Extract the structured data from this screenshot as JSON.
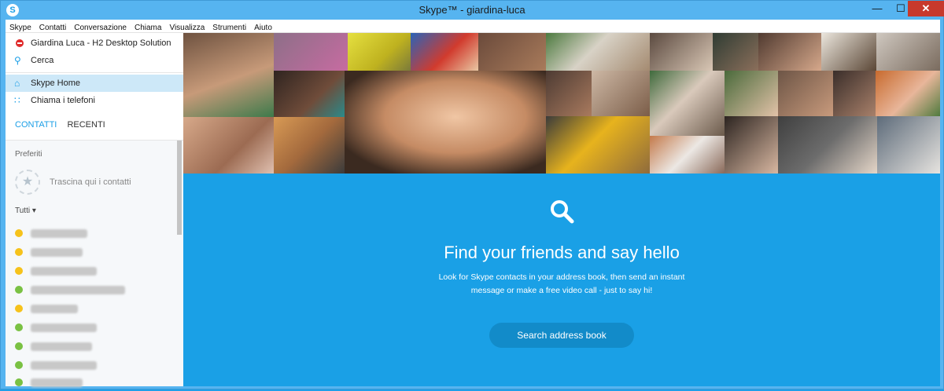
{
  "window": {
    "title": "Skype™ - giardina-luca",
    "controls": {
      "minimize": "—",
      "maximize": "☐",
      "close": "✕"
    }
  },
  "menu": [
    "Skype",
    "Contatti",
    "Conversazione",
    "Chiama",
    "Visualizza",
    "Strumenti",
    "Aiuto"
  ],
  "sidebar": {
    "profile_name": "Giardina Luca - H2 Desktop Solution",
    "search_label": "Cerca",
    "home_label": "Skype Home",
    "phones_label": "Chiama i telefoni",
    "tabs": {
      "contacts": "CONTATTI",
      "recent": "RECENTI"
    },
    "favorites_label": "Preferiti",
    "drag_here": "Trascina qui i contatti",
    "all_label": "Tutti ▾",
    "contacts": [
      {
        "status": "away"
      },
      {
        "status": "away"
      },
      {
        "status": "away"
      },
      {
        "status": "online"
      },
      {
        "status": "away"
      },
      {
        "status": "online"
      },
      {
        "status": "online"
      },
      {
        "status": "online"
      },
      {
        "status": "online"
      }
    ]
  },
  "hero": {
    "title": "Find your friends and say hello",
    "subtitle": "Look for Skype contacts in your address book, then send an instant message or make a free video call - just to say hi!",
    "button": "Search address book"
  },
  "colors": {
    "accent": "#1aa0e6",
    "button": "#128bc9",
    "away": "#f6c21b",
    "online": "#7ac143",
    "do_not_disturb": "#e02b2b"
  }
}
